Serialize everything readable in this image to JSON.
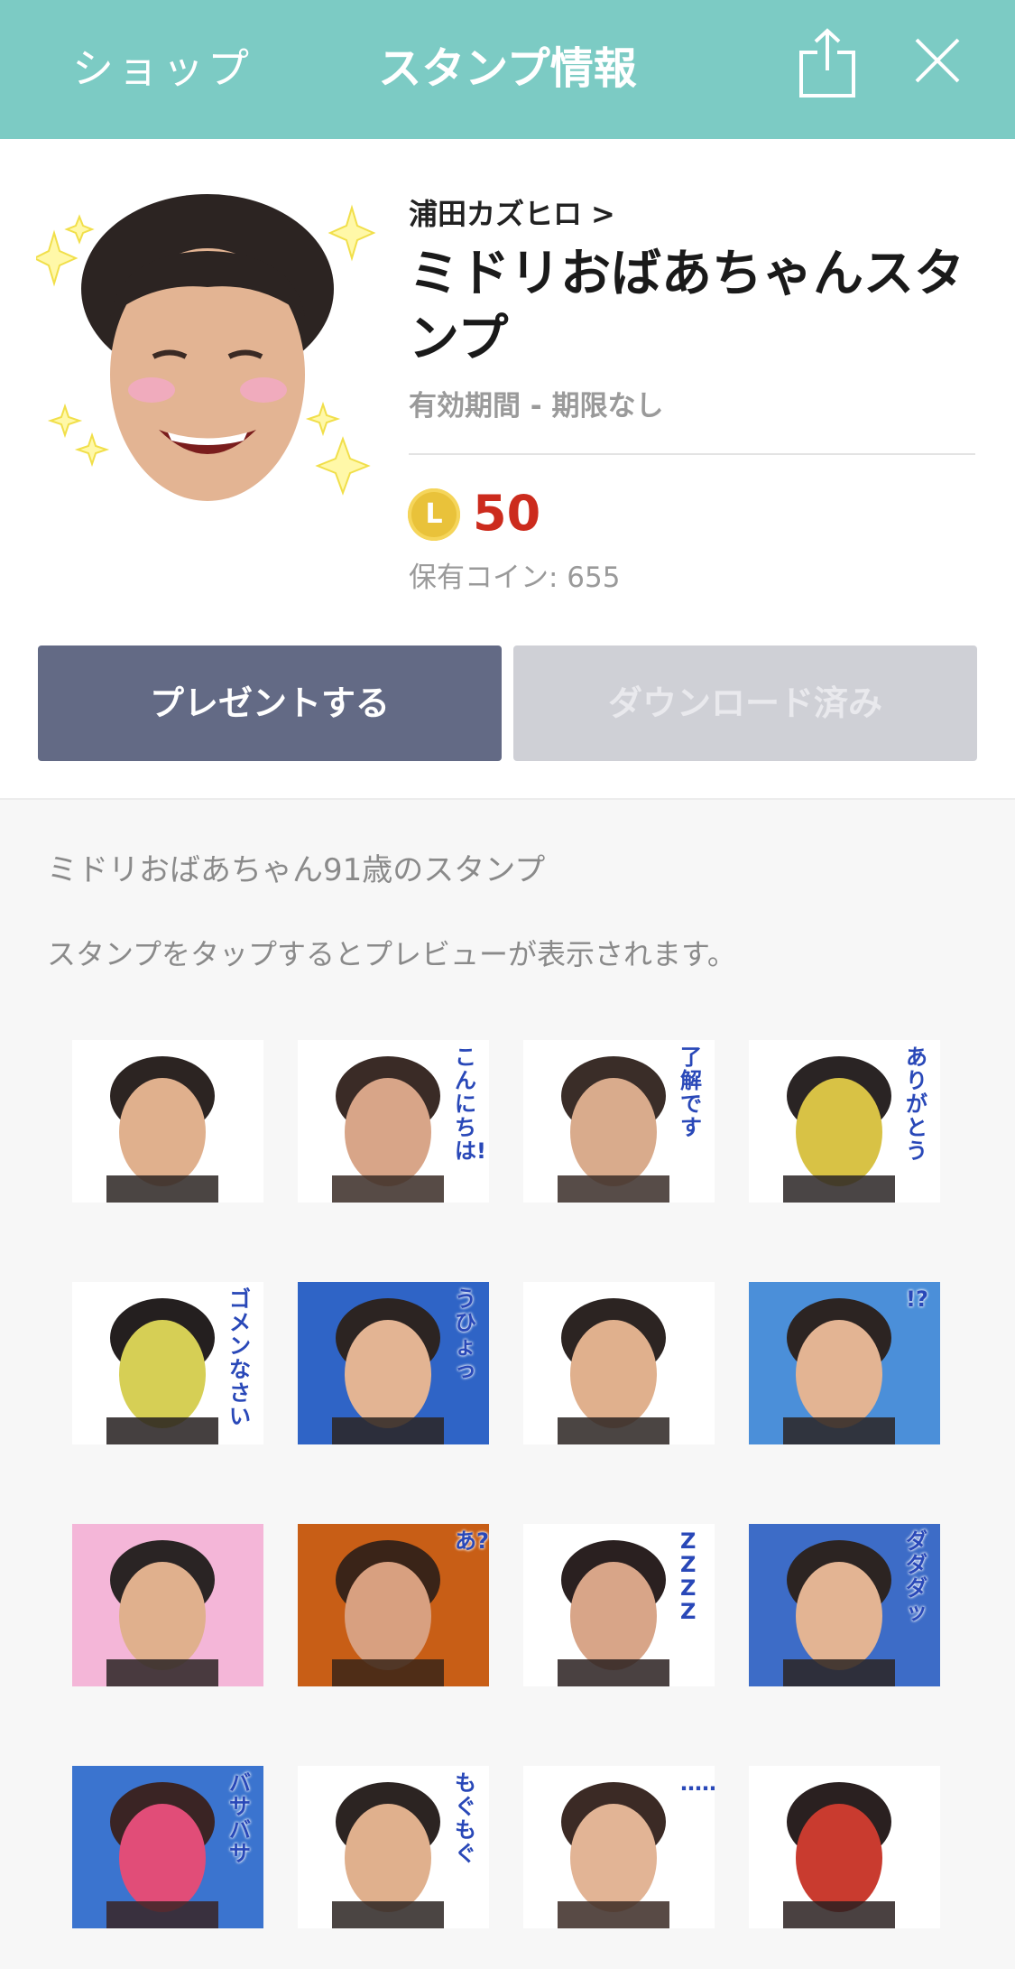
{
  "header": {
    "back_label": "ショップ",
    "title": "スタンプ情報",
    "share_icon": "share-icon",
    "close_icon": "close-icon",
    "background": "#7ccbc4"
  },
  "product": {
    "creator": "浦田カズヒロ",
    "creator_chevron": ">",
    "title": "ミドリおばあちゃんスタンプ",
    "validity": "有効期間 - 期限なし",
    "coin_symbol": "L",
    "price": "50",
    "balance": "保有コイン: 655",
    "price_color": "#cc2b1d"
  },
  "actions": {
    "present_label": "プレゼントする",
    "download_label": "ダウンロード済み"
  },
  "description": {
    "summary": "ミドリおばあちゃん91歳のスタンプ",
    "hint": "スタンプをタップするとプレビューが表示されます。"
  },
  "stickers": [
    {
      "name": "sticker-smile-sparkle",
      "caption": ""
    },
    {
      "name": "sticker-konnichiwa",
      "caption": "こんにちは!"
    },
    {
      "name": "sticker-ryoukai-desu",
      "caption": "了解です"
    },
    {
      "name": "sticker-arigatou",
      "caption": "ありがとう"
    },
    {
      "name": "sticker-gomennasai",
      "caption": "ゴメンなさい"
    },
    {
      "name": "sticker-uhyo",
      "caption": "うひょっ"
    },
    {
      "name": "sticker-surprise-profile",
      "caption": ""
    },
    {
      "name": "sticker-exclaim-question",
      "caption": "!?"
    },
    {
      "name": "sticker-peace",
      "caption": ""
    },
    {
      "name": "sticker-a-question",
      "caption": "あ?"
    },
    {
      "name": "sticker-sleeping",
      "caption": "ZZZZ"
    },
    {
      "name": "sticker-dadada",
      "caption": "ダダダッ"
    },
    {
      "name": "sticker-basa-basa",
      "caption": "バサバサ"
    },
    {
      "name": "sticker-mogumogu",
      "caption": "もぐもぐ"
    },
    {
      "name": "sticker-ellipsis",
      "caption": "……"
    },
    {
      "name": "sticker-sword",
      "caption": ""
    }
  ]
}
